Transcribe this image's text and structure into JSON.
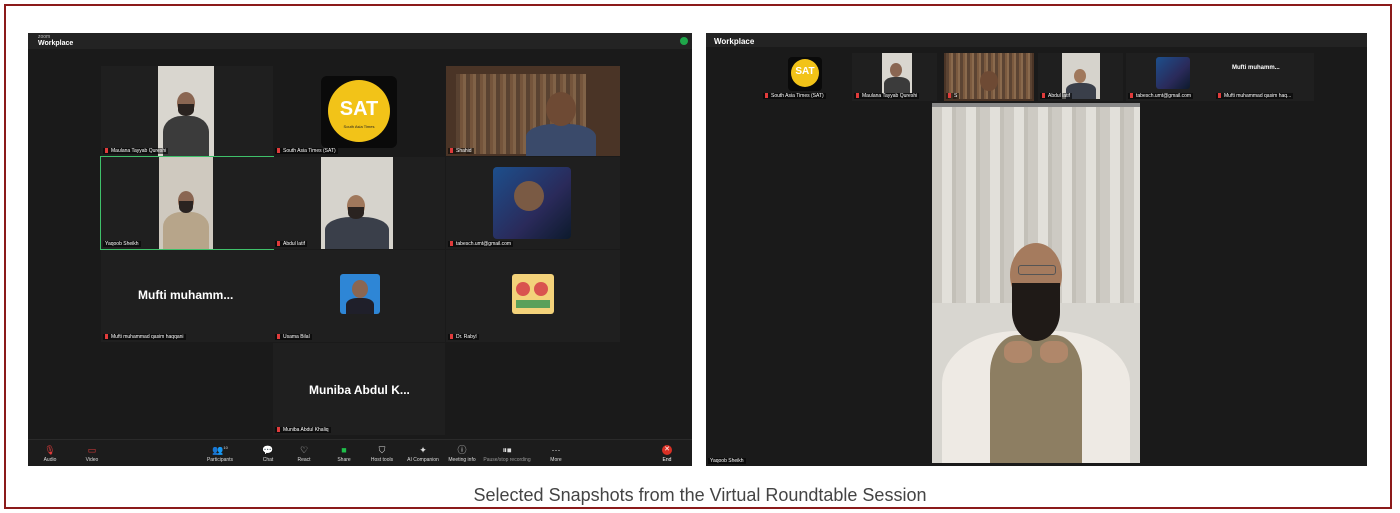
{
  "caption": "Selected Snapshots from the Virtual Roundtable Session",
  "colors": {
    "frame_border": "#8b1a1a",
    "zoom_bg": "#1a1a1a",
    "end_red": "#d93025",
    "active_speaker": "#3fc06a"
  },
  "left": {
    "app_small": "zoom",
    "window_title": "Workplace",
    "participants": [
      {
        "name": "Maulana Tayyab Qureshi"
      },
      {
        "name": "South Asia Times (SAT)"
      },
      {
        "name": "Shahid"
      },
      {
        "name": "Yaqoob Sheikh"
      },
      {
        "name": "Abdul latif"
      },
      {
        "name": "tabesch.umt@gmail.com"
      },
      {
        "name": "Mufti muhammad qasim haqqani",
        "display": "Mufti  muhamm..."
      },
      {
        "name": "Usama Bilal"
      },
      {
        "name": "Dr. Rabyl"
      },
      {
        "name": "Muniba Abdul Khaliq",
        "display": "Muniba Abdul K..."
      }
    ],
    "logo_text": "SAT",
    "logo_sub": "South Asia Times",
    "toolbar": {
      "audio": "Audio",
      "video": "Video",
      "participants": "Participants",
      "participants_count": "10",
      "chat": "Chat",
      "react": "React",
      "share": "Share",
      "host_tools": "Host tools",
      "ai_companion": "AI Companion",
      "meeting_info": "Meeting info",
      "recording": "Pause/stop recording",
      "more": "More",
      "end": "End"
    },
    "icons": [
      "mic-muted-icon",
      "video-off-icon",
      "participants-icon",
      "chat-icon",
      "react-icon",
      "share-icon",
      "shield-icon",
      "sparkle-icon",
      "info-icon",
      "record-icon",
      "more-icon",
      "end-icon"
    ]
  },
  "right": {
    "window_title": "Workplace",
    "strip": [
      {
        "name": "South Asia Times (SAT)"
      },
      {
        "name": "Maulana Tayyab Qureshi"
      },
      {
        "name": "S"
      },
      {
        "name": "Abdul latif"
      },
      {
        "name": "tabesch.umt@gmail.com"
      },
      {
        "name": "Mufti muhammad qasim haq...",
        "display": "Mufti  muhamm..."
      }
    ],
    "speaker": "Yaqoob Sheikh"
  }
}
